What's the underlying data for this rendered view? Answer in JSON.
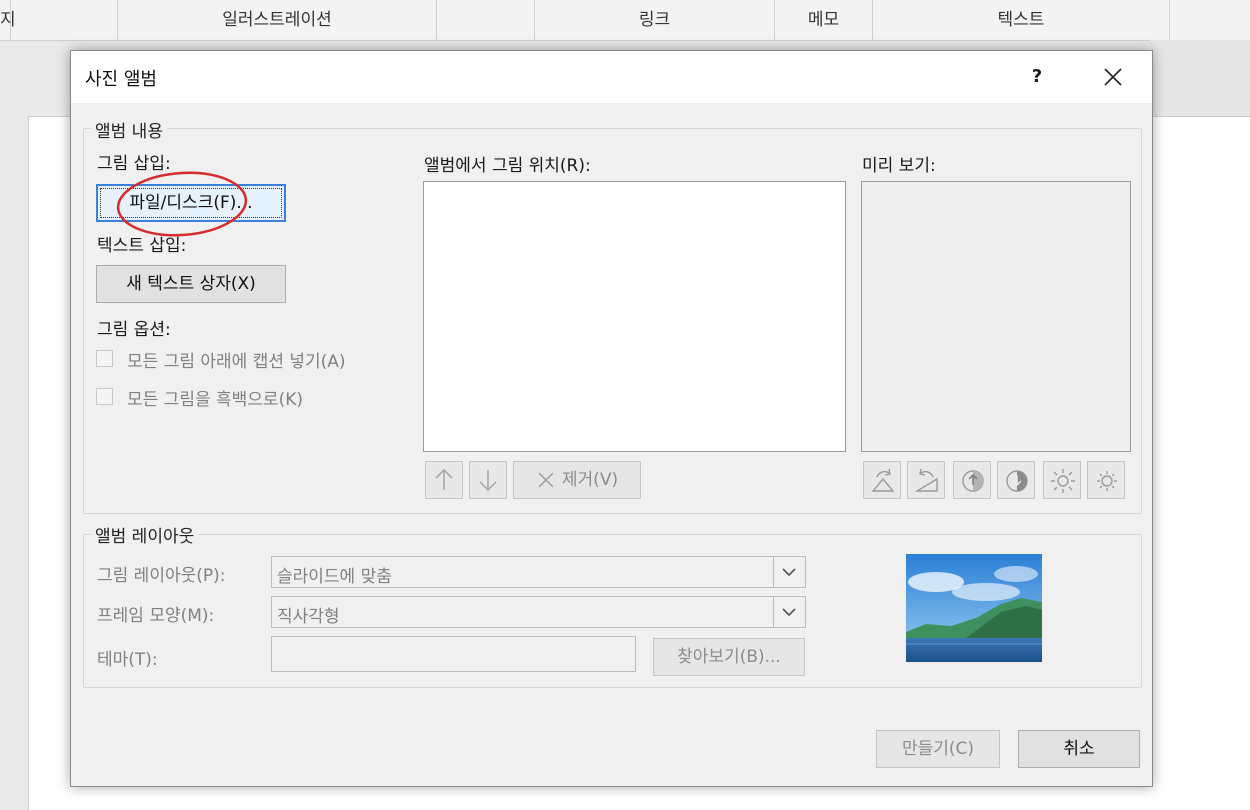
{
  "background_app": {
    "columns": [
      {
        "label": "지"
      },
      {
        "label": "일러스트레이션"
      },
      {
        "label": "링크"
      },
      {
        "label": "메모"
      },
      {
        "label": "텍스트"
      }
    ]
  },
  "dialog": {
    "title": "사진 앨범",
    "help_label": "?",
    "close_label": "✕",
    "album_content": {
      "legend": "앨범 내용",
      "insert_picture_label": "그림 삽입:",
      "file_disk_button": "파일/디스크(F)...",
      "insert_text_label": "텍스트 삽입:",
      "new_text_box_button": "새 텍스트 상자(X)",
      "picture_options_label": "그림 옵션:",
      "caption_checkbox_label": "모든 그림 아래에 캡션 넣기(A)",
      "bw_checkbox_label": "모든 그림을 흑백으로(K)",
      "pictures_in_album_label": "앨범에서 그림 위치(R):",
      "remove_button": "제거(V)",
      "preview_label": "미리 보기:"
    },
    "album_layout": {
      "legend": "앨범 레이아웃",
      "picture_layout_label": "그림 레이아웃(P):",
      "picture_layout_value": "슬라이드에 맞춤",
      "frame_shape_label": "프레임 모양(M):",
      "frame_shape_value": "직사각형",
      "theme_label": "테마(T):",
      "theme_value": "",
      "browse_button": "찾아보기(B)..."
    },
    "create_button": "만들기(C)",
    "cancel_button": "취소"
  }
}
